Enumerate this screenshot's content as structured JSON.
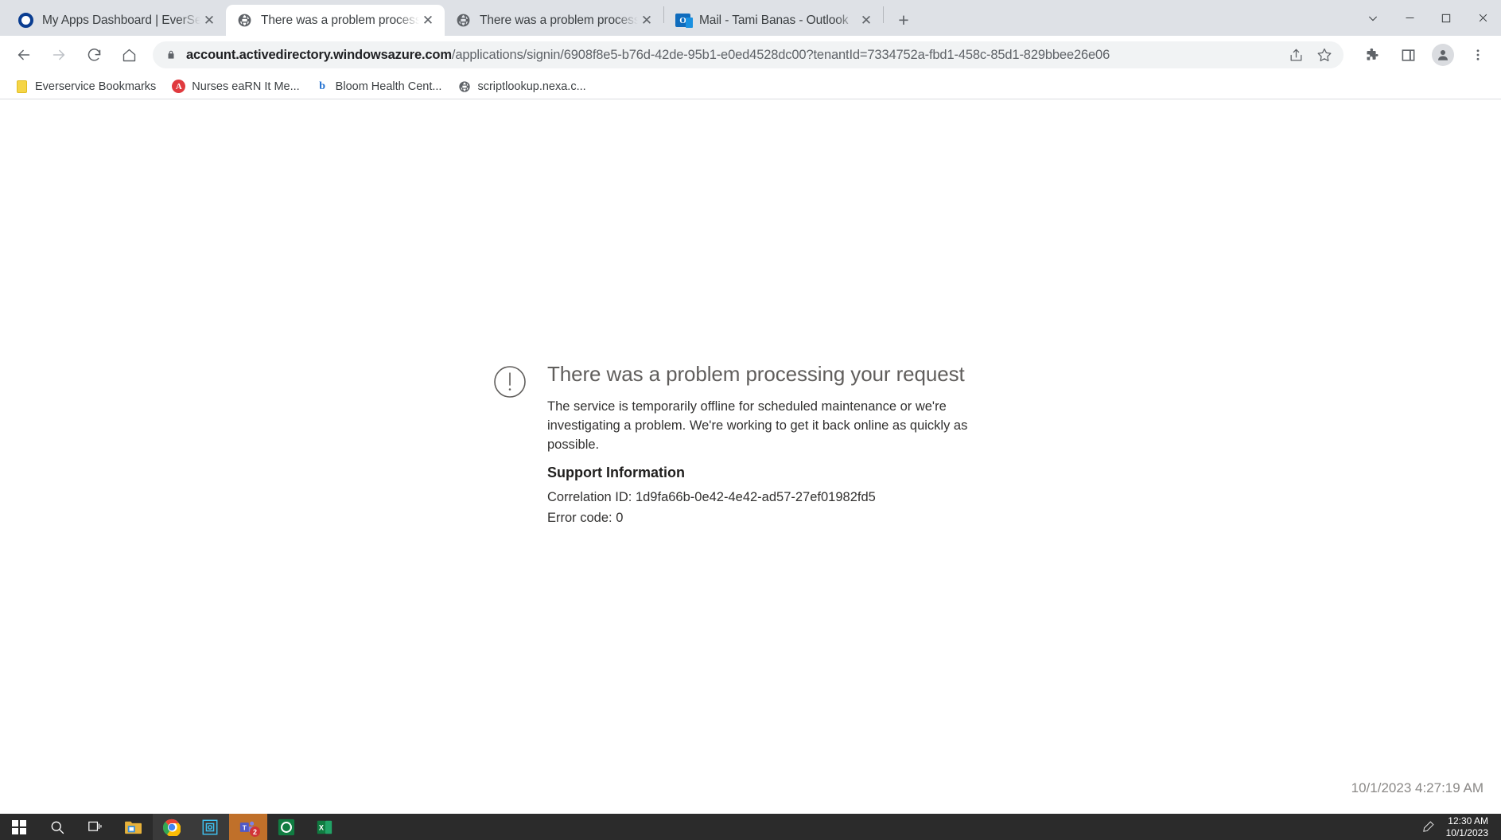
{
  "window": {
    "controls": {
      "tab_search": "⌄",
      "minimize": "—",
      "maximize": "□",
      "close": "✕"
    }
  },
  "tabs": [
    {
      "title": "My Apps Dashboard | EverService",
      "favicon": "ring-icon",
      "active": false,
      "close": "✕"
    },
    {
      "title": "There was a problem processing",
      "favicon": "globe-icon",
      "active": true,
      "close": "✕"
    },
    {
      "title": "There was a problem processing",
      "favicon": "globe-icon",
      "active": false,
      "close": "✕"
    },
    {
      "title": "Mail - Tami Banas - Outlook",
      "favicon": "outlook-icon",
      "active": false,
      "close": "✕"
    }
  ],
  "newtab_label": "+",
  "toolbar": {
    "back": "←",
    "forward": "→",
    "reload": "⟳",
    "home": "⌂",
    "omnibox": {
      "host": "account.activedirectory.windowsazure.com",
      "path": "/applications/signin/6908f8e5-b76d-42de-95b1-e0ed4528dc00?tenantId=7334752a-fbd1-458c-85d1-829bbee26e06",
      "lock_icon": "lock-icon",
      "share_icon": "share-icon",
      "star_icon": "star-icon"
    },
    "extensions_icon": "puzzle-icon",
    "sidepanel_icon": "side-panel-icon",
    "profile_icon": "profile-avatar-icon",
    "menu_icon": "three-dot-menu-icon"
  },
  "bookmarks": [
    {
      "label": "Everservice Bookmarks",
      "icon": "folder-icon"
    },
    {
      "label": "Nurses eaRN It Me...",
      "icon": "nurses-icon"
    },
    {
      "label": "Bloom Health Cent...",
      "icon": "bloom-icon"
    },
    {
      "label": "scriptlookup.nexa.c...",
      "icon": "globe-icon"
    }
  ],
  "page": {
    "error_icon": "exclamation-circle-icon",
    "title": "There was a problem processing your request",
    "description": "The service is temporarily offline for scheduled maintenance or we're investigating a problem. We're working to get it back online as quickly as possible.",
    "support_heading": "Support Information",
    "correlation_id": "Correlation ID: 1d9fa66b-0e42-4e42-ad57-27ef01982fd5",
    "error_code": "Error code: 0",
    "timestamp": "10/1/2023 4:27:19 AM"
  },
  "taskbar": {
    "start": "start-icon",
    "search": "search-icon",
    "taskview": "task-view-icon",
    "explorer": "file-explorer-icon",
    "chrome": "chrome-icon",
    "frame_app": "frame-app-icon",
    "teams": "teams-icon",
    "teams_badge": "2",
    "green_app": "green-o-app-icon",
    "excel": "excel-icon",
    "pen_icon": "pen-icon",
    "clock_time": "12:30 AM",
    "clock_date": "10/1/2023"
  },
  "colors": {
    "tabstrip_bg": "#dee1e6",
    "omnibox_bg": "#f1f3f4",
    "accent_blue": "#0a3d91",
    "taskbar_bg": "#2b2b2b",
    "error_title": "#605e5c"
  }
}
